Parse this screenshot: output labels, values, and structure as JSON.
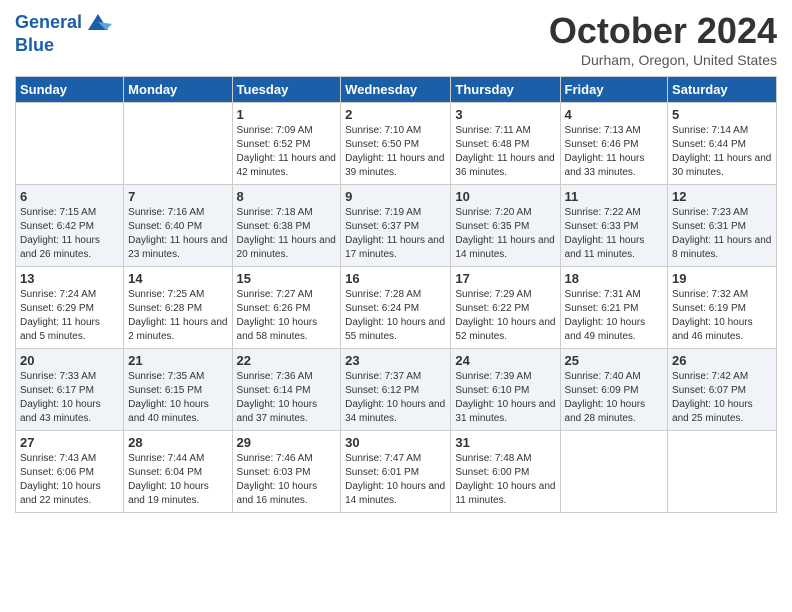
{
  "header": {
    "logo_line1": "General",
    "logo_line2": "Blue",
    "month": "October 2024",
    "location": "Durham, Oregon, United States"
  },
  "weekdays": [
    "Sunday",
    "Monday",
    "Tuesday",
    "Wednesday",
    "Thursday",
    "Friday",
    "Saturday"
  ],
  "weeks": [
    [
      {
        "num": "",
        "info": ""
      },
      {
        "num": "",
        "info": ""
      },
      {
        "num": "1",
        "info": "Sunrise: 7:09 AM\nSunset: 6:52 PM\nDaylight: 11 hours and 42 minutes."
      },
      {
        "num": "2",
        "info": "Sunrise: 7:10 AM\nSunset: 6:50 PM\nDaylight: 11 hours and 39 minutes."
      },
      {
        "num": "3",
        "info": "Sunrise: 7:11 AM\nSunset: 6:48 PM\nDaylight: 11 hours and 36 minutes."
      },
      {
        "num": "4",
        "info": "Sunrise: 7:13 AM\nSunset: 6:46 PM\nDaylight: 11 hours and 33 minutes."
      },
      {
        "num": "5",
        "info": "Sunrise: 7:14 AM\nSunset: 6:44 PM\nDaylight: 11 hours and 30 minutes."
      }
    ],
    [
      {
        "num": "6",
        "info": "Sunrise: 7:15 AM\nSunset: 6:42 PM\nDaylight: 11 hours and 26 minutes."
      },
      {
        "num": "7",
        "info": "Sunrise: 7:16 AM\nSunset: 6:40 PM\nDaylight: 11 hours and 23 minutes."
      },
      {
        "num": "8",
        "info": "Sunrise: 7:18 AM\nSunset: 6:38 PM\nDaylight: 11 hours and 20 minutes."
      },
      {
        "num": "9",
        "info": "Sunrise: 7:19 AM\nSunset: 6:37 PM\nDaylight: 11 hours and 17 minutes."
      },
      {
        "num": "10",
        "info": "Sunrise: 7:20 AM\nSunset: 6:35 PM\nDaylight: 11 hours and 14 minutes."
      },
      {
        "num": "11",
        "info": "Sunrise: 7:22 AM\nSunset: 6:33 PM\nDaylight: 11 hours and 11 minutes."
      },
      {
        "num": "12",
        "info": "Sunrise: 7:23 AM\nSunset: 6:31 PM\nDaylight: 11 hours and 8 minutes."
      }
    ],
    [
      {
        "num": "13",
        "info": "Sunrise: 7:24 AM\nSunset: 6:29 PM\nDaylight: 11 hours and 5 minutes."
      },
      {
        "num": "14",
        "info": "Sunrise: 7:25 AM\nSunset: 6:28 PM\nDaylight: 11 hours and 2 minutes."
      },
      {
        "num": "15",
        "info": "Sunrise: 7:27 AM\nSunset: 6:26 PM\nDaylight: 10 hours and 58 minutes."
      },
      {
        "num": "16",
        "info": "Sunrise: 7:28 AM\nSunset: 6:24 PM\nDaylight: 10 hours and 55 minutes."
      },
      {
        "num": "17",
        "info": "Sunrise: 7:29 AM\nSunset: 6:22 PM\nDaylight: 10 hours and 52 minutes."
      },
      {
        "num": "18",
        "info": "Sunrise: 7:31 AM\nSunset: 6:21 PM\nDaylight: 10 hours and 49 minutes."
      },
      {
        "num": "19",
        "info": "Sunrise: 7:32 AM\nSunset: 6:19 PM\nDaylight: 10 hours and 46 minutes."
      }
    ],
    [
      {
        "num": "20",
        "info": "Sunrise: 7:33 AM\nSunset: 6:17 PM\nDaylight: 10 hours and 43 minutes."
      },
      {
        "num": "21",
        "info": "Sunrise: 7:35 AM\nSunset: 6:15 PM\nDaylight: 10 hours and 40 minutes."
      },
      {
        "num": "22",
        "info": "Sunrise: 7:36 AM\nSunset: 6:14 PM\nDaylight: 10 hours and 37 minutes."
      },
      {
        "num": "23",
        "info": "Sunrise: 7:37 AM\nSunset: 6:12 PM\nDaylight: 10 hours and 34 minutes."
      },
      {
        "num": "24",
        "info": "Sunrise: 7:39 AM\nSunset: 6:10 PM\nDaylight: 10 hours and 31 minutes."
      },
      {
        "num": "25",
        "info": "Sunrise: 7:40 AM\nSunset: 6:09 PM\nDaylight: 10 hours and 28 minutes."
      },
      {
        "num": "26",
        "info": "Sunrise: 7:42 AM\nSunset: 6:07 PM\nDaylight: 10 hours and 25 minutes."
      }
    ],
    [
      {
        "num": "27",
        "info": "Sunrise: 7:43 AM\nSunset: 6:06 PM\nDaylight: 10 hours and 22 minutes."
      },
      {
        "num": "28",
        "info": "Sunrise: 7:44 AM\nSunset: 6:04 PM\nDaylight: 10 hours and 19 minutes."
      },
      {
        "num": "29",
        "info": "Sunrise: 7:46 AM\nSunset: 6:03 PM\nDaylight: 10 hours and 16 minutes."
      },
      {
        "num": "30",
        "info": "Sunrise: 7:47 AM\nSunset: 6:01 PM\nDaylight: 10 hours and 14 minutes."
      },
      {
        "num": "31",
        "info": "Sunrise: 7:48 AM\nSunset: 6:00 PM\nDaylight: 10 hours and 11 minutes."
      },
      {
        "num": "",
        "info": ""
      },
      {
        "num": "",
        "info": ""
      }
    ]
  ]
}
